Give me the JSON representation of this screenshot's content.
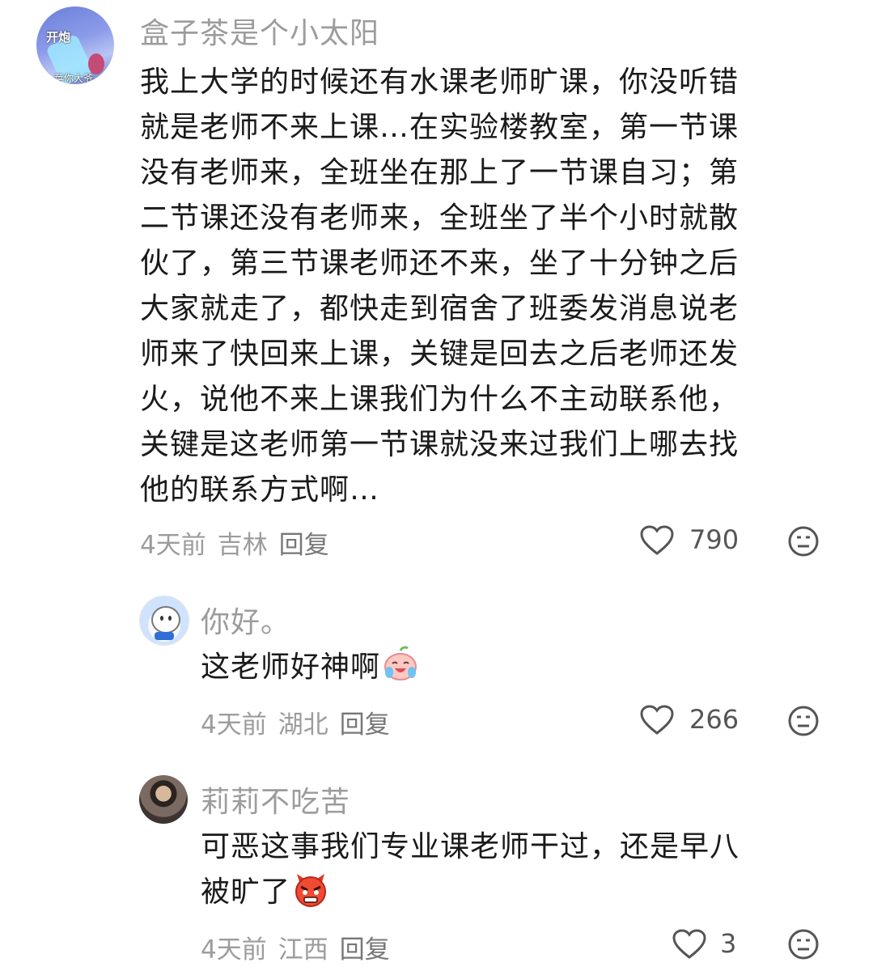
{
  "comments": [
    {
      "username": "盒子茶是个小太阳",
      "avatar_text_top": "开炮",
      "avatar_text_bottom": "苹你大爷",
      "lines": [
        "我上大学的时候还有水课老师旷课，你没听错",
        "就是老师不来上课…在实验楼教室，第一节课",
        "没有老师来，全班坐在那上了一节课自习；第",
        "二节课还没有老师来，全班坐了半个小时就散",
        "伙了，第三节课老师还不来，坐了十分钟之后",
        "大家就走了，都快走到宿舍了班委发消息说老",
        "师来了快回来上课，关键是回去之后老师还发",
        "火，说他不来上课我们为什么不主动联系他，",
        "关键是这老师第一节课就没来过我们上哪去找",
        "他的联系方式啊…"
      ],
      "time": "4天前",
      "location": "吉林",
      "reply_label": "回复",
      "likes": "790"
    },
    {
      "username": "你好。",
      "lines": [
        "这老师好神啊"
      ],
      "emoji": "laughing-crying-emoji",
      "time": "4天前",
      "location": "湖北",
      "reply_label": "回复",
      "likes": "266"
    },
    {
      "username": "莉莉不吃苦",
      "lines": [
        "可恶这事我们专业课老师干过，还是早八",
        "被旷了"
      ],
      "emoji": "angry-emoji",
      "time": "4天前",
      "location": "江西",
      "reply_label": "回复",
      "likes": "3"
    }
  ],
  "icons": {
    "like": "heart-outline-icon",
    "dislike": "frown-face-icon"
  },
  "colors": {
    "text": "#1a1a1a",
    "meta": "#9c9c9c"
  }
}
